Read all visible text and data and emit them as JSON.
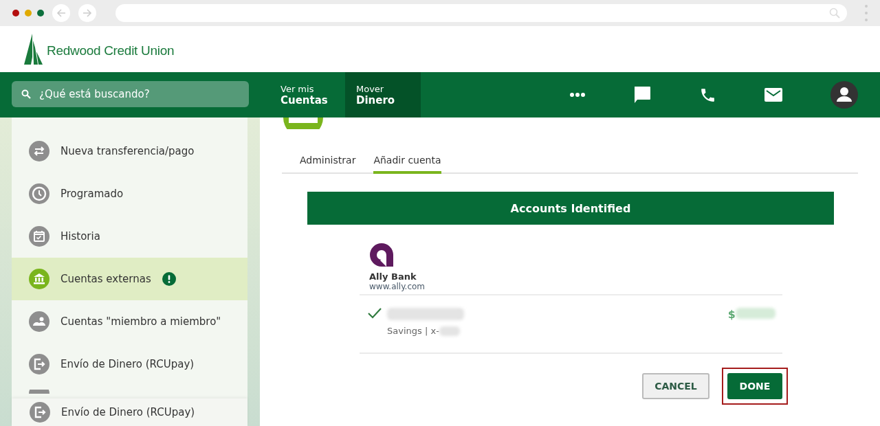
{
  "brand": {
    "name": "Redwood Credit Union"
  },
  "search": {
    "placeholder": "¿Qué está buscando?"
  },
  "nav": [
    {
      "line1": "Ver mis",
      "line2": "Cuentas",
      "selected": false
    },
    {
      "line1": "Mover",
      "line2": "Dinero",
      "selected": true
    }
  ],
  "sidebar": {
    "items": [
      {
        "label": "Nueva transferencia/pago",
        "kind": "transfer",
        "selected": false,
        "alert": false
      },
      {
        "label": "Programado",
        "kind": "clock",
        "selected": false,
        "alert": false
      },
      {
        "label": "Historia",
        "kind": "calendar",
        "selected": false,
        "alert": false
      },
      {
        "label": "Cuentas externas",
        "kind": "bank",
        "selected": true,
        "alert": true
      },
      {
        "label": "Cuentas \"miembro a miembro\"",
        "kind": "people",
        "selected": false,
        "alert": false
      },
      {
        "label": "Envío de Dinero (RCUpay)",
        "kind": "exit",
        "selected": false,
        "alert": false
      }
    ],
    "footer_item": {
      "label": "Envío de Dinero (RCUpay)",
      "kind": "exit"
    }
  },
  "tabs": [
    {
      "label": "Administrar",
      "selected": false
    },
    {
      "label": "Añadir cuenta",
      "selected": true
    }
  ],
  "panel": {
    "title": "Accounts Identified",
    "bank": {
      "name": "Ally Bank",
      "url": "www.ally.com"
    },
    "account": {
      "checked": true,
      "detail": "Savings | x-",
      "currency": "$"
    },
    "buttons": [
      {
        "label": "CANCEL",
        "kind": "secondary"
      },
      {
        "label": "DONE",
        "kind": "primary",
        "highlighted": true
      }
    ]
  }
}
